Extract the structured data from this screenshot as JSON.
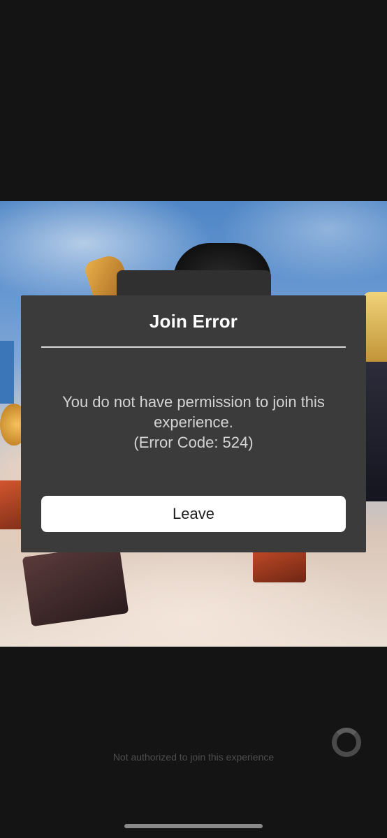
{
  "dialog": {
    "title": "Join Error",
    "message_line1": "You do not have permission to join this",
    "message_line2": "experience.",
    "error_code": "(Error Code: 524)",
    "leave_label": "Leave"
  },
  "status": {
    "text": "Not authorized to join this experience"
  },
  "icons": {
    "loading": "loading-spinner-icon"
  },
  "colors": {
    "dialog_bg": "#3b3b3c",
    "button_bg": "#ffffff",
    "screen_bg": "#141414"
  }
}
